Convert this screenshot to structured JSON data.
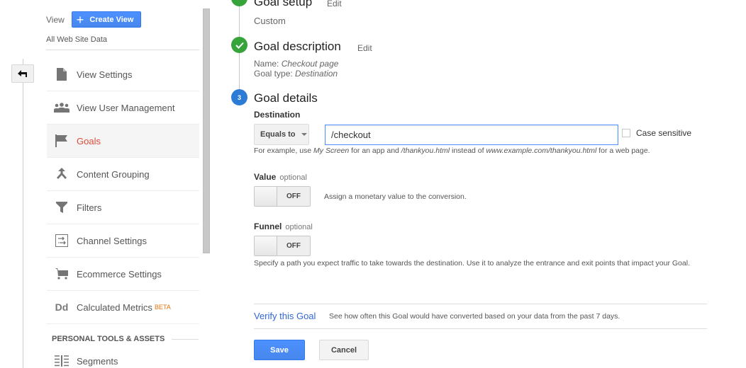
{
  "sidebar": {
    "view_label": "View",
    "create_view_label": "Create View",
    "view_name": "All Web Site Data",
    "items": [
      {
        "label": "View Settings",
        "icon": "document-icon"
      },
      {
        "label": "View User Management",
        "icon": "people-icon"
      },
      {
        "label": "Goals",
        "icon": "flag-icon",
        "active": true
      },
      {
        "label": "Content Grouping",
        "icon": "merge-icon"
      },
      {
        "label": "Filters",
        "icon": "filter-icon"
      },
      {
        "label": "Channel Settings",
        "icon": "channel-icon"
      },
      {
        "label": "Ecommerce Settings",
        "icon": "cart-icon"
      },
      {
        "label": "Calculated Metrics",
        "icon": "dd-icon",
        "badge": "BETA"
      }
    ],
    "section_header": "PERSONAL TOOLS & ASSETS",
    "segments_label": "Segments",
    "calc_icon_text": "Dd"
  },
  "steps": {
    "setup": {
      "title": "Goal setup",
      "edit": "Edit",
      "sub": "Custom"
    },
    "description": {
      "title": "Goal description",
      "edit": "Edit",
      "name_label": "Name:",
      "name_value": "Checkout page",
      "type_label": "Goal type:",
      "type_value": "Destination"
    },
    "details": {
      "number": "3",
      "title": "Goal details"
    }
  },
  "destination": {
    "label": "Destination",
    "match_type": "Equals to",
    "value": "/checkout",
    "case_sensitive_label": "Case sensitive",
    "case_sensitive_checked": false,
    "hint_parts": [
      "For example, use ",
      "My Screen",
      " for an app and ",
      "/thankyou.html",
      " instead of ",
      "www.example.com/thankyou.html",
      " for a web page."
    ]
  },
  "value_field": {
    "label": "Value",
    "optional": "optional",
    "toggle_state": "OFF",
    "description": "Assign a monetary value to the conversion."
  },
  "funnel_field": {
    "label": "Funnel",
    "optional": "optional",
    "toggle_state": "OFF",
    "description": "Specify a path you expect traffic to take towards the destination. Use it to analyze the entrance and exit points that impact your Goal."
  },
  "verify": {
    "link": "Verify this Goal",
    "description": "See how often this Goal would have converted based on your data from the past 7 days."
  },
  "buttons": {
    "save": "Save",
    "cancel": "Cancel"
  },
  "colors": {
    "primary_blue": "#4d90fe",
    "active_red": "#dd4b39",
    "step_done_green": "#36a33b",
    "step_current_blue": "#2c7bd4",
    "link_blue": "#3367d6",
    "beta_orange": "#e8710a"
  }
}
